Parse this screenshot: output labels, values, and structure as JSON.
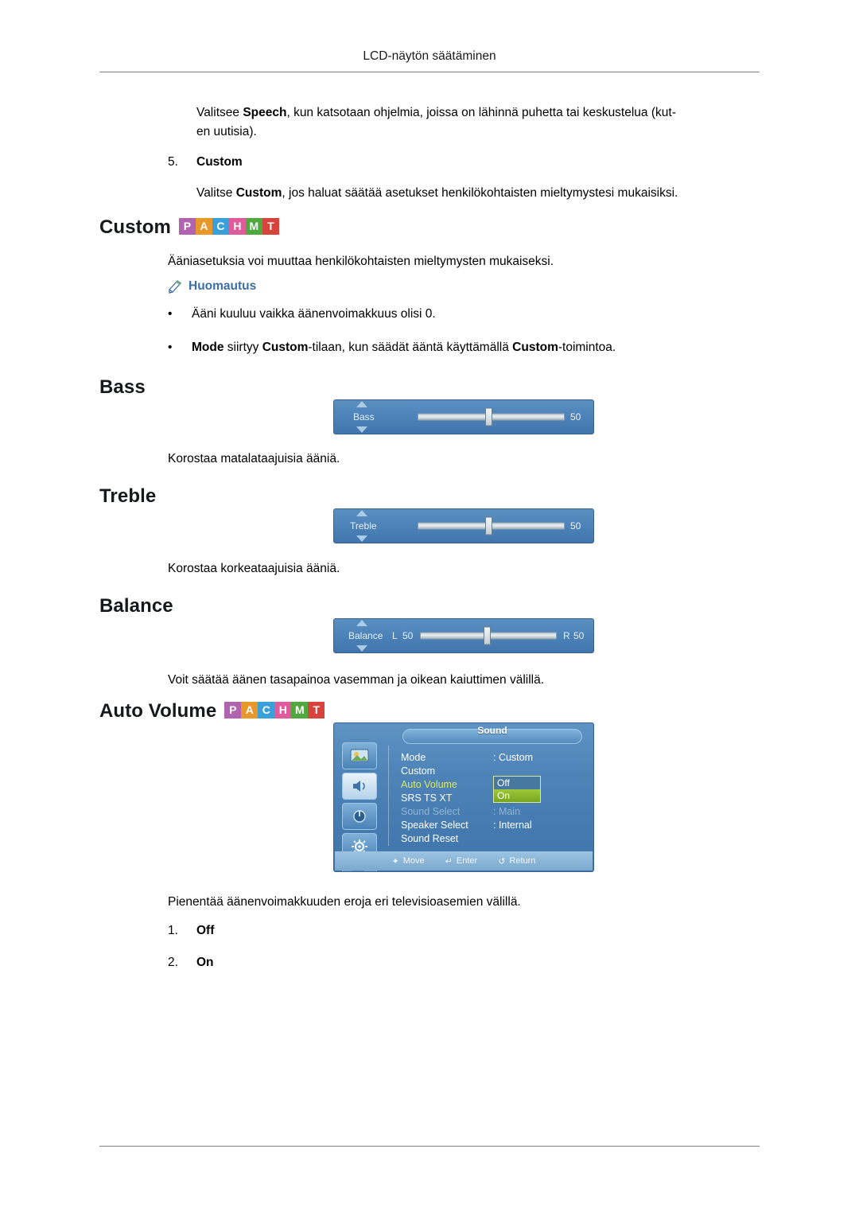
{
  "header": {
    "running_title": "LCD-näytön säätäminen"
  },
  "intro": {
    "speech_text_1": "Valitsee ",
    "speech_bold": "Speech",
    "speech_text_2": ", kun katsotaan ohjelmia, joissa on lähinnä puhetta tai keskustelua (kut-",
    "speech_text_3": "en uutisia).",
    "list_number": "5.",
    "list_label": "Custom",
    "custom_text_1": "Valitse ",
    "custom_bold": "Custom",
    "custom_text_2": ", jos haluat säätää asetukset henkilökohtaisten mieltymystesi mukaisiksi."
  },
  "badge": {
    "letters": [
      "P",
      "A",
      "C",
      "H",
      "M",
      "T"
    ]
  },
  "sections": [
    {
      "title": "Custom",
      "has_badge": true,
      "body": "Ääniasetuksia voi muuttaa henkilökohtaisten mieltymysten mukaiseksi."
    },
    {
      "title": "Bass",
      "has_badge": false,
      "caption": "Korostaa matalataajuisia ääniä."
    },
    {
      "title": "Treble",
      "has_badge": false,
      "caption": "Korostaa korkeataajuisia ääniä."
    },
    {
      "title": "Balance",
      "has_badge": false,
      "caption": "Voit säätää äänen tasapainoa vasemman ja oikean kaiuttimen välillä."
    },
    {
      "title": "Auto Volume",
      "has_badge": true,
      "caption": "Pienentää äänenvoimakkuuden eroja eri televisioasemien välillä."
    }
  ],
  "note": {
    "label": "Huomautus",
    "bullets": [
      {
        "dot": "•",
        "plain_1": "Ääni kuuluu vaikka äänenvoimakkuus olisi 0."
      },
      {
        "dot": "•",
        "b1": "Mode",
        "p1": " siirtyy ",
        "b2": "Custom",
        "p2": "-tilaan, kun säädät ääntä käyttämällä ",
        "b3": "Custom",
        "p3": "-toimintoa."
      }
    ]
  },
  "osd_bass": {
    "label": "Bass",
    "value": "50"
  },
  "osd_treble": {
    "label": "Treble",
    "value": "50"
  },
  "osd_balance": {
    "label": "Balance",
    "left_label": "L",
    "left_value": "50",
    "right_label": "R",
    "right_value": "50"
  },
  "osd_sound_menu": {
    "title": "Sound",
    "rows": [
      {
        "label": "Mode",
        "value": ": Custom",
        "dim": false
      },
      {
        "label": "Custom",
        "value": "",
        "dim": false
      },
      {
        "label": "Auto Volume",
        "value": "",
        "dim": false,
        "highlight": true
      },
      {
        "label": "SRS TS XT",
        "value": "",
        "dim": false
      },
      {
        "label": "Sound Select",
        "value": ": Main",
        "dim": true
      },
      {
        "label": "Speaker Select",
        "value": ": Internal",
        "dim": false
      },
      {
        "label": "Sound Reset",
        "value": "",
        "dim": false
      }
    ],
    "options": [
      "Off",
      "On"
    ],
    "selected_option": "On",
    "footer": [
      {
        "glyph": "✦",
        "label": "Move"
      },
      {
        "glyph": "↵",
        "label": "Enter"
      },
      {
        "glyph": "↺",
        "label": "Return"
      }
    ]
  },
  "auto_volume_options": [
    {
      "number": "1.",
      "label": "Off"
    },
    {
      "number": "2.",
      "label": "On"
    }
  ]
}
